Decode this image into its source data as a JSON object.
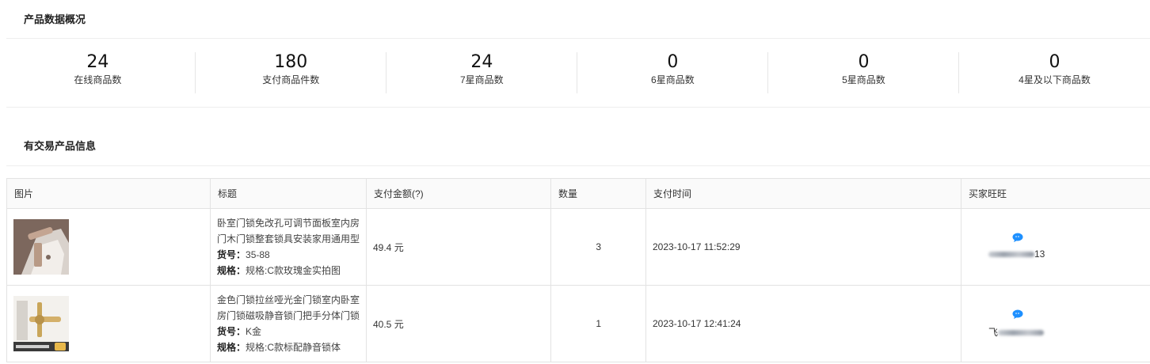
{
  "overview": {
    "title": "产品数据概况",
    "stats": [
      {
        "value": "24",
        "label": "在线商品数"
      },
      {
        "value": "180",
        "label": "支付商品件数"
      },
      {
        "value": "24",
        "label": "7星商品数"
      },
      {
        "value": "0",
        "label": "6星商品数"
      },
      {
        "value": "0",
        "label": "5星商品数"
      },
      {
        "value": "0",
        "label": "4星及以下商品数"
      }
    ]
  },
  "transactions": {
    "title": "有交易产品信息",
    "columns": [
      "图片",
      "标题",
      "支付金额(?)",
      "数量",
      "支付时间",
      "买家旺旺"
    ],
    "sku_label": "货号：",
    "spec_label": "规格：",
    "rows": [
      {
        "title": "卧室门锁免改孔可调节面板室内房门木门锁整套锁具安装家用通用型",
        "sku": "35-88",
        "spec": "规格:C款玫瑰金实拍图",
        "amount": "49.4 元",
        "quantity": "3",
        "time": "2023-10-17 11:52:29",
        "buyer_prefix": "",
        "buyer_suffix": "13"
      },
      {
        "title": "金色门锁拉丝哑光金门锁室内卧室房门锁磁吸静音锁门把手分体门锁",
        "sku": "K金",
        "spec": "规格:C款标配静音锁体",
        "amount": "40.5 元",
        "quantity": "1",
        "time": "2023-10-17 12:41:24",
        "buyer_prefix": "飞",
        "buyer_suffix": ""
      }
    ]
  },
  "colors": {
    "accent_blue": "#1e90ff"
  },
  "icons": {
    "wangwang": "wangwang-chat-icon"
  }
}
